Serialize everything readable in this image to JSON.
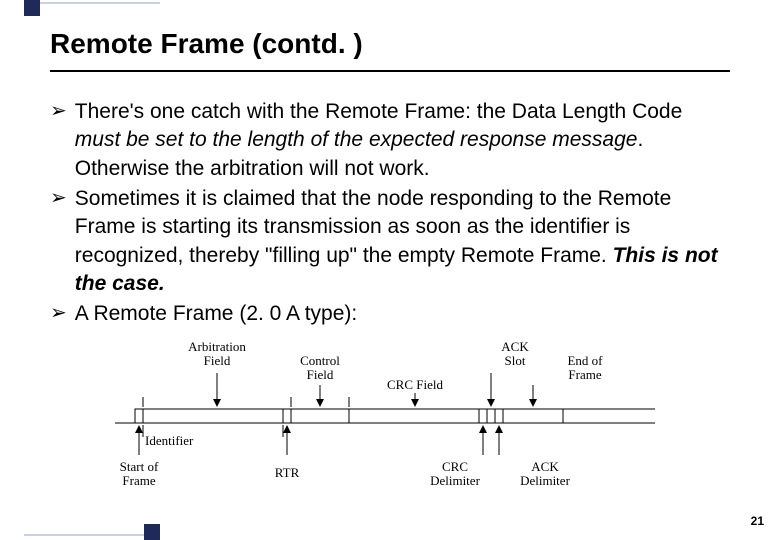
{
  "slide": {
    "title": "Remote Frame (contd. )",
    "page_number": "21",
    "bullets": [
      {
        "prefix": "There's one catch with the Remote Frame: the Data Length Code ",
        "italic": "must be set to the length of the expected response message",
        "suffix": ". Otherwise the arbitration will not work."
      },
      {
        "prefix": "Sometimes it is claimed that the node responding to the Remote Frame is starting its transmission as soon as the identifier is recognized, thereby \"filling up\" the empty Remote Frame. ",
        "bold": "This is not the case.",
        "suffix": ""
      },
      {
        "prefix": "A Remote Frame (2. 0 A type):",
        "italic": "",
        "suffix": ""
      }
    ]
  },
  "diagram": {
    "top_labels": {
      "arbitration": "Arbitration Field",
      "control": "Control Field",
      "crc": "CRC Field",
      "ack": "ACK Slot",
      "eof": "End of Frame"
    },
    "bottom_labels": {
      "identifier": "Identifier",
      "sof": "Start of Frame",
      "rtr": "RTR",
      "crc_delim": "CRC Delimiter",
      "ack_delim": "ACK Delimiter"
    }
  }
}
